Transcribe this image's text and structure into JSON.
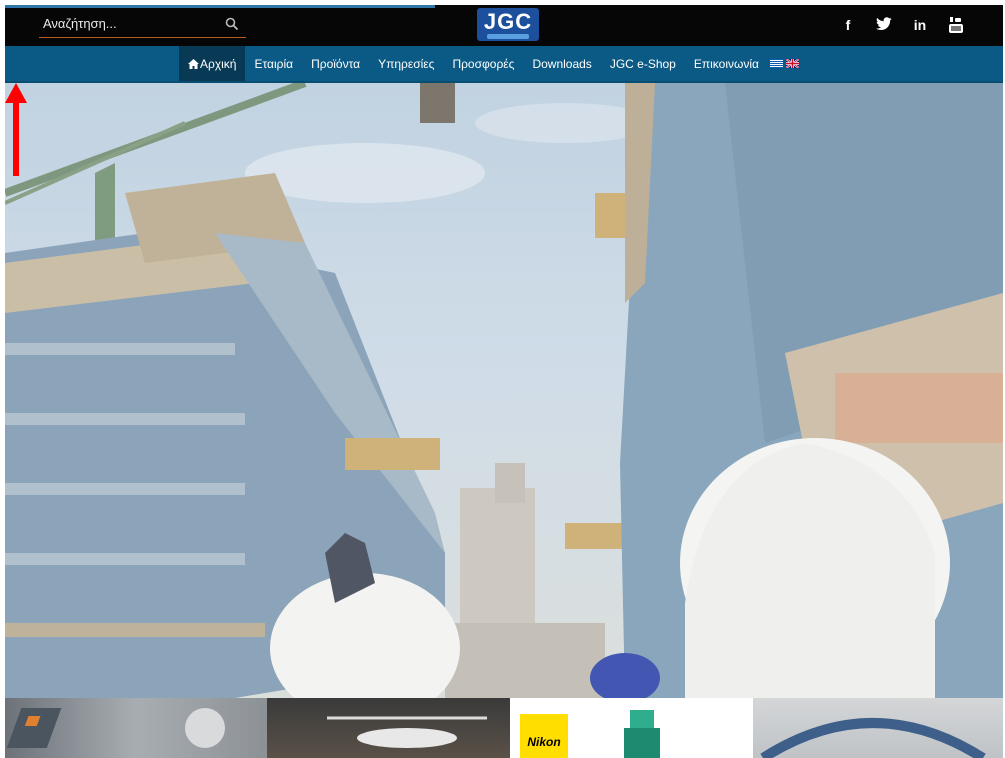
{
  "search": {
    "placeholder": "Αναζήτηση..."
  },
  "logo": {
    "text": "JGC"
  },
  "social": {
    "facebook": "f",
    "twitter": "twitter-bird-icon",
    "linkedin": "in",
    "youtube": "youtube-icon"
  },
  "nav": {
    "items": [
      {
        "label": "Αρχική",
        "active": true
      },
      {
        "label": "Εταιρία"
      },
      {
        "label": "Προϊόντα"
      },
      {
        "label": "Υπηρεσίες"
      },
      {
        "label": "Προσφορές"
      },
      {
        "label": "Downloads"
      },
      {
        "label": "JGC e-Shop"
      },
      {
        "label": "Επικοινωνία"
      }
    ],
    "languages": [
      "greek-flag-icon",
      "uk-flag-icon"
    ]
  },
  "promo": {
    "nikon_label": "Nikon"
  },
  "colors": {
    "topbar": "#060606",
    "navbar": "#0b5a85",
    "nav_active": "#083a55",
    "search_underline": "#b85c1e",
    "logo_bg": "#1c4f9c",
    "annotation_arrow": "#ff0000"
  }
}
